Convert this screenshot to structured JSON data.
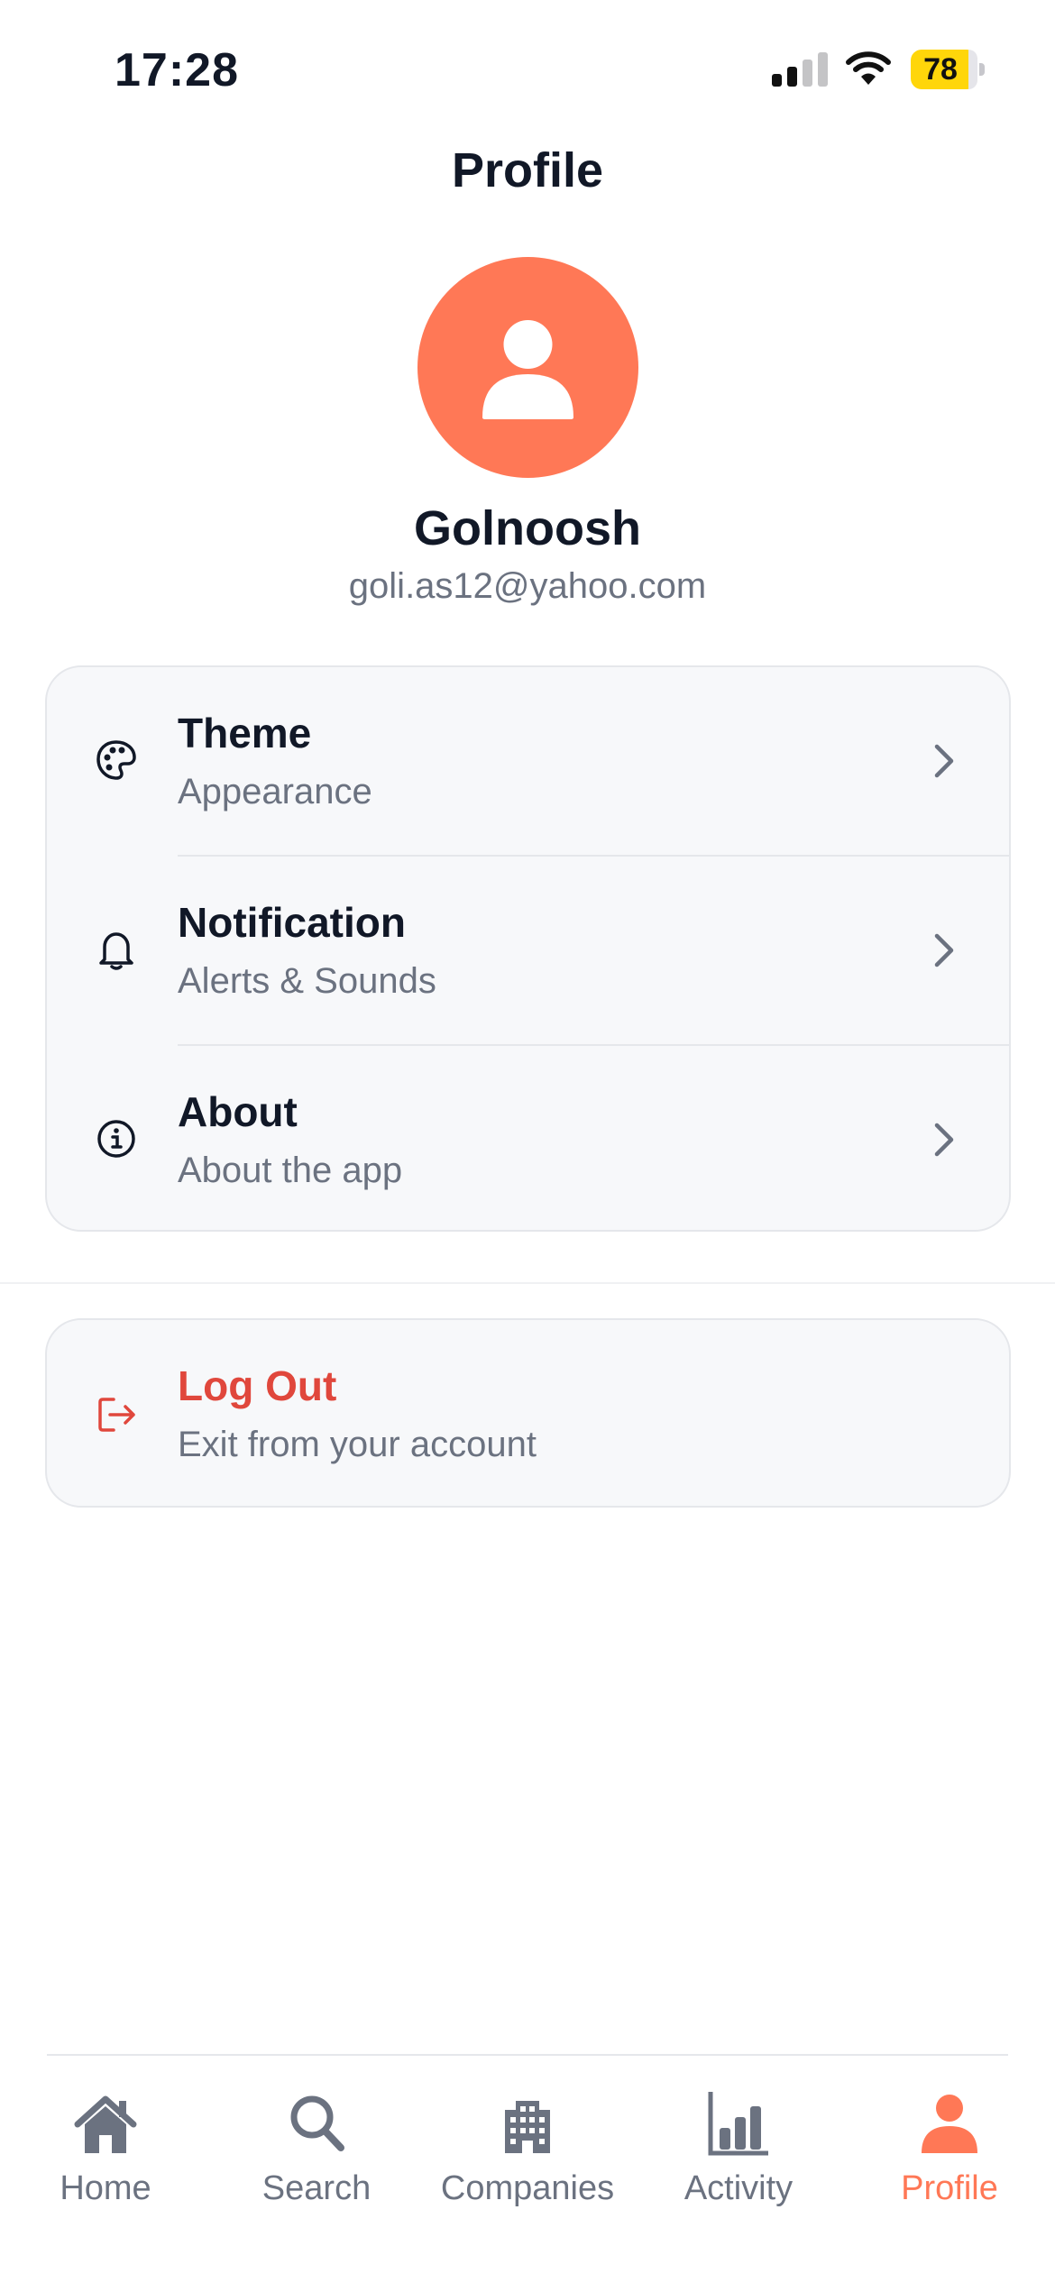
{
  "status_bar": {
    "time": "17:28",
    "battery": "78",
    "battery_color": "#ffd60a"
  },
  "header": {
    "title": "Profile"
  },
  "profile": {
    "name": "Golnoosh",
    "email": "goli.as12@yahoo.com",
    "avatar_color": "#ff7856",
    "avatar_icon": "person-icon"
  },
  "settings": [
    {
      "title": "Theme",
      "subtitle": "Appearance",
      "icon": "palette-icon"
    },
    {
      "title": "Notification",
      "subtitle": "Alerts & Sounds",
      "icon": "bell-icon"
    },
    {
      "title": "About",
      "subtitle": "About the app",
      "icon": "info-icon"
    }
  ],
  "logout": {
    "title": "Log Out",
    "subtitle": "Exit from your account",
    "icon": "logout-icon",
    "color": "#e0473c"
  },
  "tab_bar": {
    "items": [
      {
        "label": "Home",
        "icon": "home-icon"
      },
      {
        "label": "Search",
        "icon": "search-icon"
      },
      {
        "label": "Companies",
        "icon": "building-icon"
      },
      {
        "label": "Activity",
        "icon": "bar-chart-icon"
      },
      {
        "label": "Profile",
        "icon": "person-icon",
        "active": true
      }
    ],
    "active_color": "#ff7856",
    "inactive_color": "#6b7280"
  }
}
